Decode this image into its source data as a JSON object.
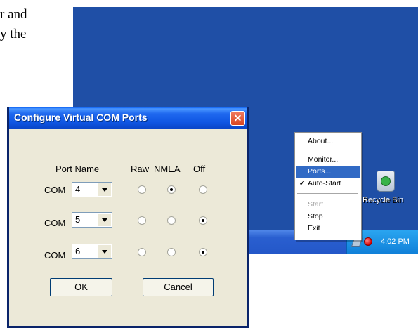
{
  "document": {
    "line1": "r and",
    "line2": "y the"
  },
  "desktop": {
    "recycle_label": "Recycle Bin",
    "clock": "4:02 PM"
  },
  "menu": {
    "items": [
      {
        "label": "About..."
      },
      {
        "label": "Monitor..."
      },
      {
        "label": "Ports..."
      },
      {
        "label": "Auto-Start",
        "check": "✔"
      },
      {
        "label": "Start"
      },
      {
        "label": "Stop"
      },
      {
        "label": "Exit"
      }
    ]
  },
  "dialog": {
    "title": "Configure Virtual COM Ports",
    "close_glyph": "✕",
    "header": {
      "port_name": "Port Name",
      "raw": "Raw",
      "nmea": "NMEA",
      "off": "Off"
    },
    "rows": [
      {
        "prefix": "COM",
        "value": "4",
        "selected_mode": "NMEA"
      },
      {
        "prefix": "COM",
        "value": "5",
        "selected_mode": "Off"
      },
      {
        "prefix": "COM",
        "value": "6",
        "selected_mode": "Off"
      }
    ],
    "buttons": {
      "ok": "OK",
      "cancel": "Cancel"
    }
  },
  "colors": {
    "desktop": "#1f4fa6",
    "titlebar": "#0f56e3",
    "menu_selected": "#316ac5",
    "close_button": "#d8431f"
  }
}
